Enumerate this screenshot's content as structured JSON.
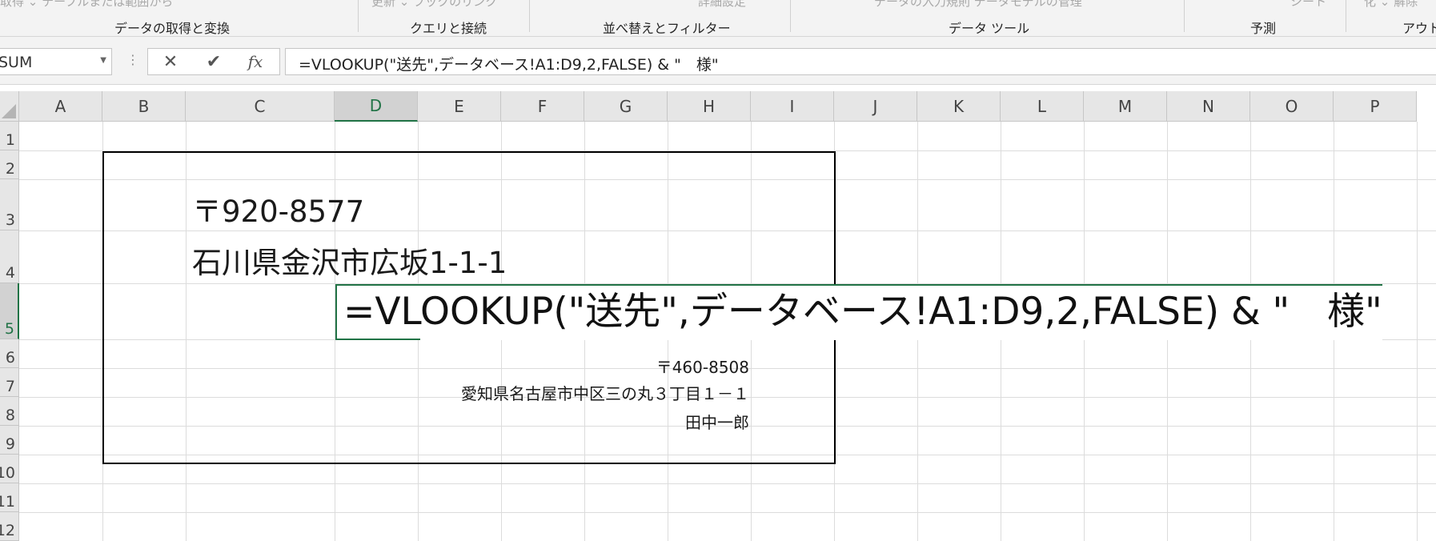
{
  "ribbon": {
    "groups": [
      {
        "faint": "取得 ⌄  テーブルまたは範囲から",
        "label": "データの取得と変換"
      },
      {
        "faint": "更新 ⌄  ブックのリンク",
        "label": "クエリと接続"
      },
      {
        "faint": "詳細設定",
        "label": "並べ替えとフィルター"
      },
      {
        "faint": "データの入力規則  データモデルの管理",
        "label": "データ ツール"
      },
      {
        "faint": "シート",
        "label": "予測"
      },
      {
        "faint": "化 ⌄  解除",
        "label": "アウト"
      }
    ]
  },
  "formula_bar": {
    "name_box": "SUM",
    "cancel_icon": "✕",
    "enter_icon": "✔",
    "fx_label": "fx",
    "formula": "=VLOOKUP(\"送先\",データベース!A1:D9,2,FALSE) & \"　様\""
  },
  "grid": {
    "columns": [
      "A",
      "B",
      "C",
      "D",
      "E",
      "F",
      "G",
      "H",
      "I",
      "J",
      "K",
      "L",
      "M",
      "N",
      "O",
      "P"
    ],
    "selected_column": "D",
    "rows": [
      "1",
      "2",
      "3",
      "4",
      "5",
      "6",
      "7",
      "8",
      "9",
      "10",
      "11",
      "12"
    ],
    "selected_row": "5",
    "cells": {
      "C3": "〒920-8577",
      "C4": "石川県金沢市広坂1-1-1",
      "D5_editing": "=VLOOKUP(\"送先\",データベース!A1:D9,2,FALSE) & \"　様\"",
      "H6": "〒460-8508",
      "H7": "愛知県名古屋市中区三の丸３丁目１－１",
      "H8": "田中一郎"
    }
  }
}
